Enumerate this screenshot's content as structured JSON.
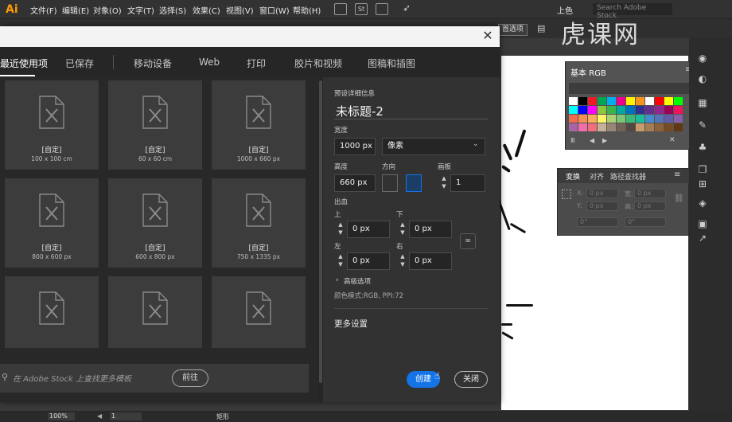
{
  "menubar": {
    "logo": "Ai",
    "items": [
      "文件(F)",
      "编辑(E)",
      "对象(O)",
      "文字(T)",
      "选择(S)",
      "效果(C)",
      "视图(V)",
      "窗口(W)",
      "帮助(H)"
    ],
    "right_label": "上色",
    "stock_search": "Search Adobe Stock"
  },
  "controlbar": {
    "prefs_button": "首选项"
  },
  "watermark": "虎课网",
  "dialog": {
    "tabs": [
      "最近使用项",
      "已保存",
      "移动设备",
      "Web",
      "打印",
      "胶片和视频",
      "图稿和插图"
    ],
    "active_tab": "最近使用项",
    "presets": [
      {
        "name": "[自定]",
        "size": "100 x 100 cm"
      },
      {
        "name": "[自定]",
        "size": "60 x 60 cm"
      },
      {
        "name": "[自定]",
        "size": "1000 x 660 px"
      },
      {
        "name": "[自定]",
        "size": "800 x 600 px"
      },
      {
        "name": "[自定]",
        "size": "600 x 800 px"
      },
      {
        "name": "[自定]",
        "size": "750 x 1335 px"
      },
      {
        "name": "",
        "size": ""
      },
      {
        "name": "",
        "size": ""
      },
      {
        "name": "",
        "size": ""
      }
    ],
    "stock": {
      "placeholder": "在 Adobe Stock 上查找更多模板",
      "go": "前往"
    },
    "details": {
      "section_title": "预设详细信息",
      "doc_name": "未标题-2",
      "width_label": "宽度",
      "width_value": "1000 px",
      "unit_value": "像素",
      "height_label": "高度",
      "height_value": "660 px",
      "orientation_label": "方向",
      "artboards_label": "画板",
      "artboards_value": "1",
      "bleed_label": "出血",
      "top_label": "上",
      "bottom_label": "下",
      "left_label": "左",
      "right_label": "右",
      "bleed_top": "0 px",
      "bleed_bottom": "0 px",
      "bleed_left": "0 px",
      "bleed_right": "0 px",
      "advanced": "高级选项",
      "color_mode": "颜色模式:RGB, PPI:72",
      "more_settings": "更多设置"
    },
    "create_button": "创建",
    "close_button": "关闭"
  },
  "swatches_panel": {
    "title": "基本 RGB",
    "colors": [
      "#ffffff",
      "#000000",
      "#ed1c24",
      "#00a651",
      "#00aeef",
      "#ec008c",
      "#fff200",
      "#f7941d",
      "#ffffff",
      "#ff0000",
      "#ffff00",
      "#00ff00",
      "#00ffff",
      "#0000ff",
      "#ff00ff",
      "#8dc63f",
      "#39b54a",
      "#00a99d",
      "#0072bc",
      "#2e3192",
      "#662d91",
      "#92278f",
      "#9e005d",
      "#ed145b",
      "#f26c4f",
      "#f68e56",
      "#fbaf5d",
      "#fff568",
      "#acd373",
      "#7cc576",
      "#3cb878",
      "#1abc9c",
      "#448ccb",
      "#5674b9",
      "#605ca8",
      "#8560a8",
      "#a864a8",
      "#f06eaa",
      "#f26d7d",
      "#c7b299",
      "#998675",
      "#736357",
      "#534741",
      "#c69c6d",
      "#a67c52",
      "#8c6239",
      "#754c24",
      "#603913"
    ]
  },
  "transform_panel": {
    "tabs": [
      "变换",
      "对齐",
      "路径查找器"
    ],
    "x_label": "X:",
    "x_value": "0 px",
    "w_label": "宽:",
    "w_value": "0 px",
    "y_label": "Y:",
    "y_value": "0 px",
    "h_label": "高:",
    "h_value": "0 px",
    "rot_value": "0°",
    "shear_value": "0°"
  },
  "statusbar": {
    "zoom": "100%",
    "page": "1",
    "tool": "矩形"
  }
}
